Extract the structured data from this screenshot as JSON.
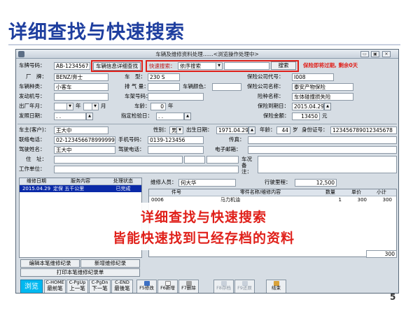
{
  "slide": {
    "title": "详细查找与快速搜索",
    "page_number": "5"
  },
  "window": {
    "title": "车辆及维修资料处理……<浏览操作处理中>",
    "btn_min": "▭",
    "btn_max": "▣",
    "btn_close": "✕"
  },
  "vehicle": {
    "plate_label": "车牌号码：",
    "plate_value": "AB-1234567",
    "detail_search_button": "车辆信息详细查找",
    "quick_search_label": "快速搜索：",
    "quick_search_mode": "依序搜索",
    "quick_search_value": "",
    "search_button": "搜索",
    "insurance_warning": "保险即将过期, 剩余0天",
    "brand_label": "厂　牌：",
    "brand_value": "BENZ/奔士",
    "model_label": "车　型：",
    "model_value": "230 S",
    "type_label": "车辆种类：",
    "type_value": "小客车",
    "displacement_label": "排 气 量：",
    "displacement_value": "",
    "color_label": "车辆颜色：",
    "color_value": "",
    "engine_label": "发动机号：",
    "engine_value": "",
    "frame_label": "车架号码：",
    "frame_value": "",
    "mfg_label": "出厂年月：",
    "year_unit": "年",
    "month_unit": "月",
    "age_label": "车龄：",
    "age_value": "0",
    "age_unit": "年",
    "cert_label": "发照日期：",
    "cert_value": ". .",
    "next_inspect_label": "指定检验日：",
    "next_inspect_value": ". ."
  },
  "insurance": {
    "code_label": "保险公司代号：",
    "code_value": "I008",
    "company_label": "保险公司名称：",
    "company_value": "泰安产物保险",
    "type_label": "险种名称：",
    "type_value": "车体碰撞损失险",
    "expire_label": "保险到期日：",
    "expire_value": "2015.04.29",
    "amount_label": "保险金额：",
    "amount_value": "13450",
    "amount_unit": "元"
  },
  "owner": {
    "name_label": "车主(客户)：",
    "name_value": "王大中",
    "gender_label": "性别：",
    "gender_value": "男",
    "birth_label": "出生日期：",
    "birth_value": "1971.04.29",
    "age_label": "年龄：",
    "age_value": "44",
    "age_unit": "岁",
    "id_label": "身份证号：",
    "id_value": "123456789012345678",
    "phone_label": "联络电话：",
    "phone_value": "02-123456678999999",
    "mobile_label": "手机号码：",
    "mobile_value": "0139-123456",
    "fax_label": "传真：",
    "fax_value": "",
    "driver_label": "驾驶姓名：",
    "driver_value": "王大中",
    "driver_phone_label": "驾驶电话：",
    "driver_phone_value": "",
    "email_label": "电子邮箱：",
    "email_value": "",
    "address_label": "住　址：",
    "address_value": "",
    "work_label": "工作单位：",
    "work_value": "",
    "note_label": "车况备注："
  },
  "history": {
    "headers": [
      "维修日期",
      "服务内容",
      "处理状态"
    ],
    "rows": [
      [
        "2015.04.29",
        "定保 五千公里",
        "已完成"
      ]
    ]
  },
  "service": {
    "person_label": "维修人员：",
    "person_value": "何大华",
    "mileage_label": "行驶里程：",
    "mileage_value": "12,500",
    "headers": [
      "件号",
      "零件名称/维修内容",
      "数量",
      "单价",
      "小计"
    ],
    "rows": [
      [
        "0006",
        "马力机油",
        "1",
        "300",
        "300"
      ]
    ],
    "total_value": "300"
  },
  "overlay": {
    "line1": "详细查找与快速搜索",
    "line2": "皆能快速找到已经存档的资料"
  },
  "buttons": {
    "edit_record": "编辑本笔维修纪录",
    "new_record": "新增维修纪录",
    "print_record": "打印本笔维修纪录单",
    "browse": "浏览",
    "first_top": "C-HOME",
    "first_bottom": "最前笔",
    "prev_top": "C-PgUp",
    "prev_bottom": "上一笔",
    "next_top": "C-PgDn",
    "next_bottom": "下一笔",
    "last_top": "C-END",
    "last_bottom": "最後笔",
    "f5": "F5修改",
    "f6": "F6新增",
    "f7": "F7删除",
    "f8": "F8存档",
    "f9": "F9还原",
    "exit": "结束"
  }
}
